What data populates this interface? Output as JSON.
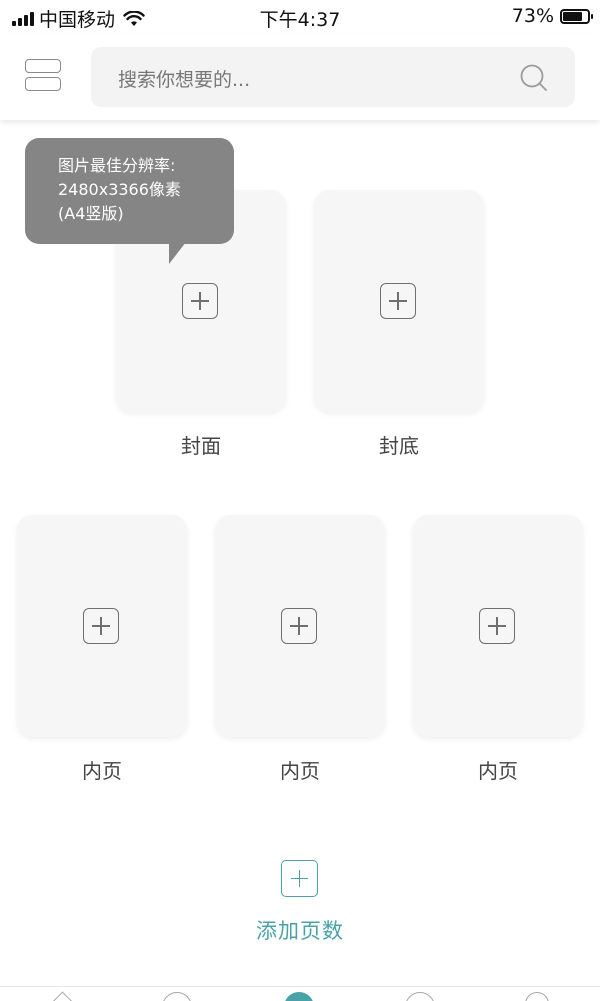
{
  "status_bar": {
    "carrier": "中国移动",
    "time": "下午4:37",
    "battery": "73%",
    "battery_level": 0.73
  },
  "header": {
    "search_placeholder": "搜索你想要的..."
  },
  "tooltip": {
    "text": "图片最佳分辨率:\n2480x3366像素\n(A4竖版)"
  },
  "covers": [
    {
      "label": "封面"
    },
    {
      "label": "封底"
    }
  ],
  "inner_pages": [
    {
      "label": "内页"
    },
    {
      "label": "内页"
    },
    {
      "label": "内页"
    }
  ],
  "add_pages": {
    "label": "添加页数"
  },
  "colors": {
    "accent": "#4aa2a8",
    "tooltip_bg": "#858585",
    "card_bg": "#f6f6f6"
  }
}
